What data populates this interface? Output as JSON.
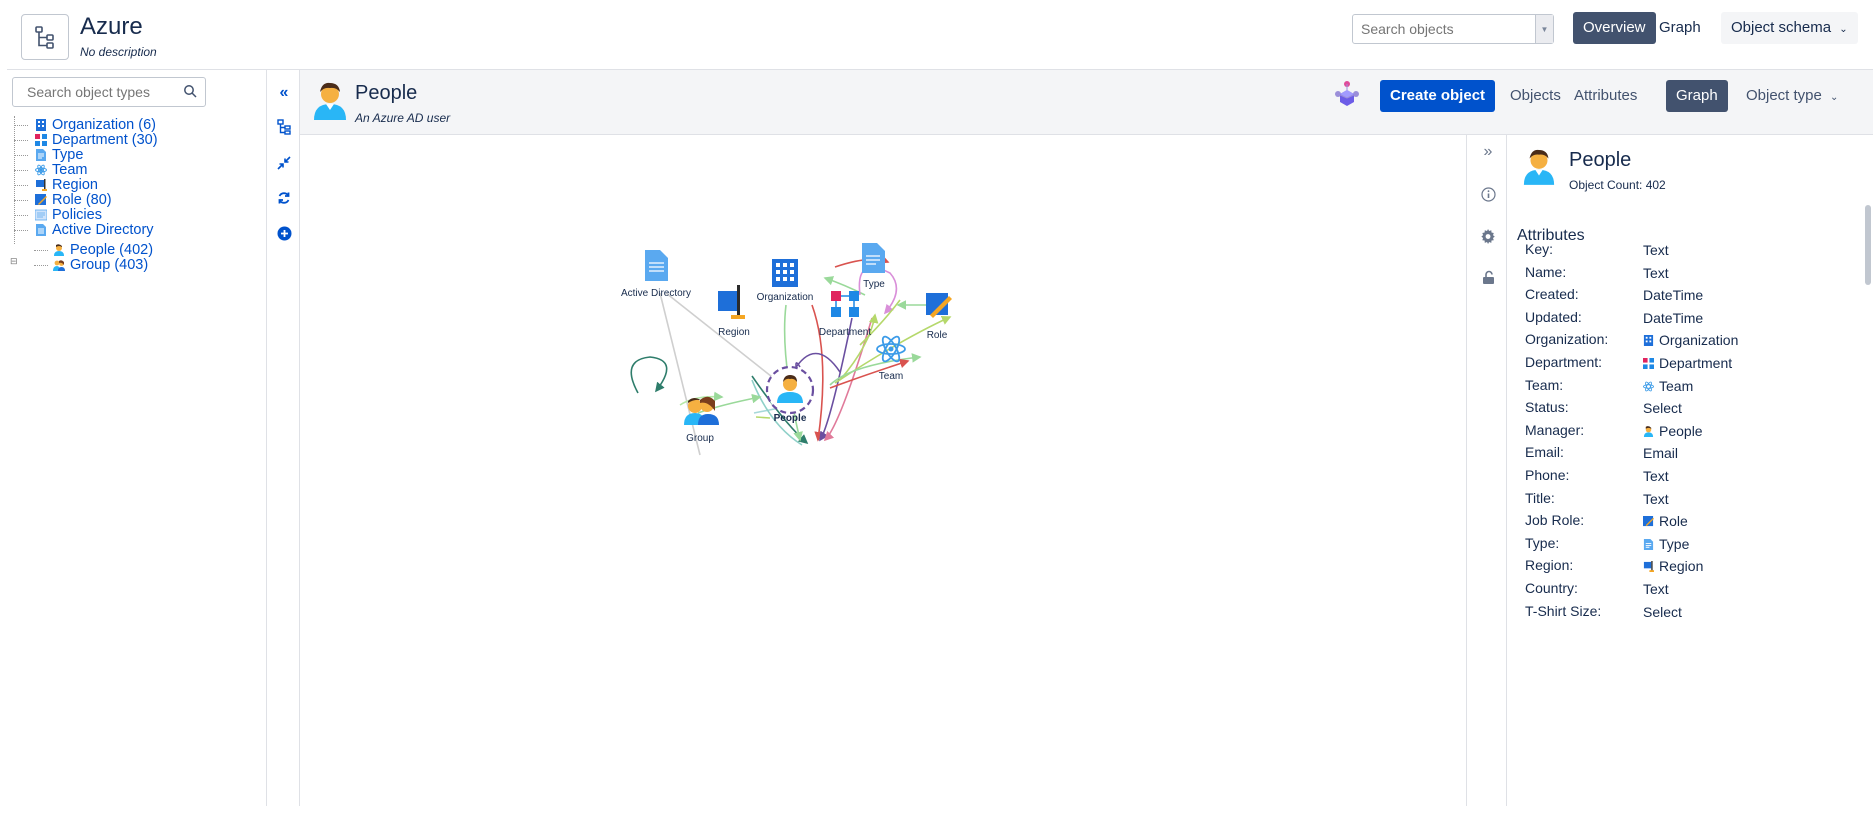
{
  "app": {
    "title": "Azure",
    "description": "No description",
    "search_placeholder": "Search objects",
    "nav": {
      "overview": "Overview",
      "graph": "Graph",
      "object_schema": "Object schema"
    }
  },
  "sidebar": {
    "search_placeholder": "Search object types",
    "items": [
      {
        "label": "Organization (6)",
        "icon": "organization-icon"
      },
      {
        "label": "Department (30)",
        "icon": "department-icon"
      },
      {
        "label": "Type",
        "icon": "type-icon"
      },
      {
        "label": "Team",
        "icon": "team-icon"
      },
      {
        "label": "Region",
        "icon": "region-icon"
      },
      {
        "label": "Role (80)",
        "icon": "role-icon"
      },
      {
        "label": "Policies",
        "icon": "policies-icon"
      },
      {
        "label": "Active Directory",
        "icon": "active-directory-icon"
      }
    ],
    "children": [
      {
        "label": "People (402)",
        "icon": "people-icon"
      },
      {
        "label": "Group (403)",
        "icon": "group-icon"
      }
    ]
  },
  "object": {
    "title": "People",
    "description": "An Azure AD user",
    "create_button": "Create object",
    "tabs": {
      "objects": "Objects",
      "attributes": "Attributes",
      "graph": "Graph",
      "object_type": "Object type"
    }
  },
  "graph": {
    "nodes": {
      "active_directory": "Active Directory",
      "organization": "Organization",
      "type": "Type",
      "region": "Region",
      "department": "Department",
      "role": "Role",
      "team": "Team",
      "group": "Group",
      "people": "People"
    }
  },
  "detail": {
    "title": "People",
    "count": "Object Count: 402",
    "section": "Attributes",
    "attributes": [
      {
        "key": "Key:",
        "value": "Text"
      },
      {
        "key": "Name:",
        "value": "Text"
      },
      {
        "key": "Created:",
        "value": "DateTime"
      },
      {
        "key": "Updated:",
        "value": "DateTime"
      },
      {
        "key": "Organization:",
        "value": "Organization",
        "icon": "organization-icon"
      },
      {
        "key": "Department:",
        "value": "Department",
        "icon": "department-icon"
      },
      {
        "key": "Team:",
        "value": "Team",
        "icon": "team-icon"
      },
      {
        "key": "Status:",
        "value": "Select"
      },
      {
        "key": "Manager:",
        "value": "People",
        "icon": "people-icon"
      },
      {
        "key": "Email:",
        "value": "Email"
      },
      {
        "key": "Phone:",
        "value": "Text"
      },
      {
        "key": "Title:",
        "value": "Text"
      },
      {
        "key": "Job Role:",
        "value": "Role",
        "icon": "role-icon"
      },
      {
        "key": "Type:",
        "value": "Type",
        "icon": "type-icon"
      },
      {
        "key": "Region:",
        "value": "Region",
        "icon": "region-icon"
      },
      {
        "key": "Country:",
        "value": "Text"
      },
      {
        "key": "T-Shirt Size:",
        "value": "Select"
      }
    ]
  },
  "colors": {
    "primary": "#0052cc",
    "active_tab": "#42526e",
    "link": "#0052cc"
  }
}
